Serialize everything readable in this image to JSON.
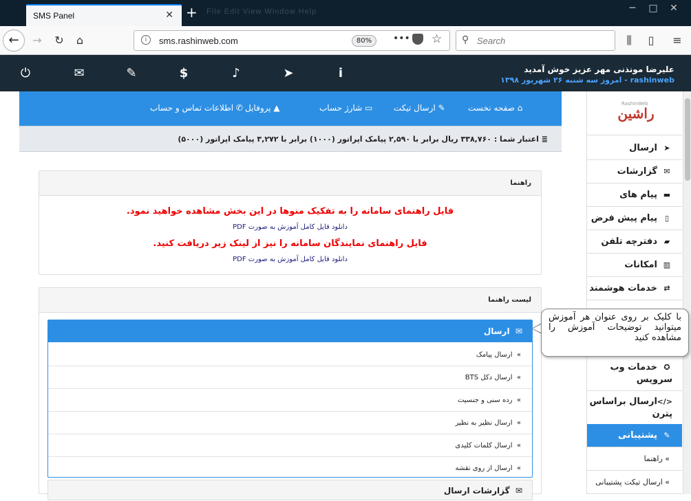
{
  "browser": {
    "tab_title": "SMS Panel",
    "tab_close": "✕",
    "new_tab": "+",
    "url": "sms.rashinweb.com",
    "zoom": "80%",
    "search_placeholder": "Search",
    "ghost_menu": "File  Edit  View  Window  Help"
  },
  "header": {
    "user": "علیرضا مونذنی مهر عزیز خوش آمدید",
    "date": "rashinweb - امروز سه شنبه ۲۶ شهریور ۱۳۹۸"
  },
  "nav": {
    "items": [
      "صفحه نخست",
      "ارسال تیکت",
      "شارژ حساب",
      "پروفایل",
      "اطلاعات تماس و حساب"
    ]
  },
  "credit": "اعتبار شما : ۳۳۸,۷۶۰ ریال برابر با ۲,۵۹۰ پیامک اپراتور (۱۰۰۰) برابر با ۳,۲۷۲ پیامک اپراتور (۵۰۰۰)",
  "guide": {
    "title": "راهنما",
    "line1": "فایل راهنمای سامانه را به تفکیک منوها در این بخش مشاهده خواهید نمود.",
    "dl1": "دانلود فایل کامل آموزش به صورت PDF",
    "line2": "فایل راهنمای نمایندگان سامانه را نیز از لینک زیر دریافت کنید.",
    "dl2": "دانلود فایل کامل آموزش به صورت PDF"
  },
  "guide_list": {
    "title": "لیست راهنما",
    "section": "ارسال",
    "items": [
      "ارسال پیامک",
      "ارسال دکل BTS",
      "رده سنی و جنسیت",
      "ارسال نظیر به نظیر",
      "ارسال کلمات کلیدی",
      "ارسال از روی نقشه"
    ],
    "section2": "گزارشات ارسال"
  },
  "tooltip": "با کلیک بر روی عنوان هر آموزش میتوانید توضیحات آموزش را مشاهده کنید",
  "sidebar": {
    "logo": "راشین وب",
    "logo_small": "RashinWeb",
    "items": [
      "ارسال",
      "گزارشات ارسال",
      "پیام های دریافتی",
      "پیام پیش فرض",
      "دفترچه تلفن",
      "امکانات پیشرفته",
      "خدمات هوشمند"
    ],
    "tall": [
      "خدمات وب سرویس",
      "ارسال براساس پترن"
    ],
    "active": "پشتیبانی",
    "subs": [
      "راهنما",
      "ارسال تیکت پشتیبانی"
    ]
  }
}
